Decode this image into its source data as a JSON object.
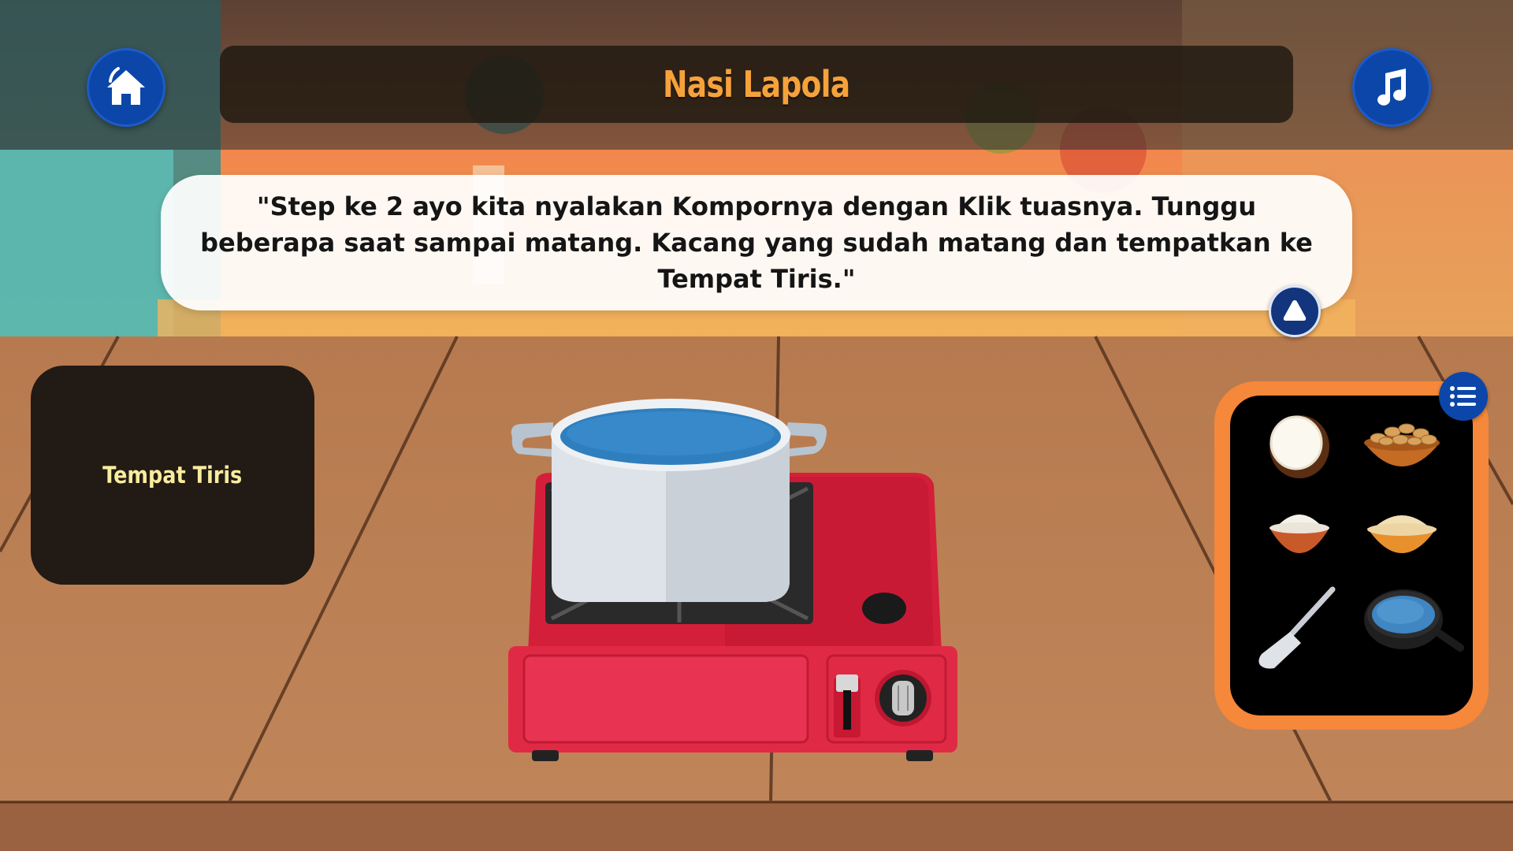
{
  "header": {
    "title": "Nasi Lapola"
  },
  "buttons": {
    "home_icon": "home-icon",
    "music_icon": "music-note-icon",
    "next_icon": "triangle-up-icon",
    "menu_icon": "list-icon"
  },
  "instruction": {
    "text": "\"Step ke 2 ayo kita nyalakan Kompornya dengan Klik tuasnya. Tunggu beberapa saat sampai matang. Kacang yang sudah matang dan tempatkan ke Tempat Tiris.\""
  },
  "drain_area": {
    "label": "Tempat Tiris"
  },
  "ingredients": [
    {
      "name": "coconut"
    },
    {
      "name": "peanuts"
    },
    {
      "name": "flour"
    },
    {
      "name": "rice"
    },
    {
      "name": "spatula"
    },
    {
      "name": "frying-pan"
    }
  ],
  "colors": {
    "accent_blue": "#0c46a8",
    "title_orange": "#f6a23b",
    "panel_orange": "#f5883a",
    "drain_label": "#f8ec9e",
    "stove_red": "#e02a45"
  }
}
